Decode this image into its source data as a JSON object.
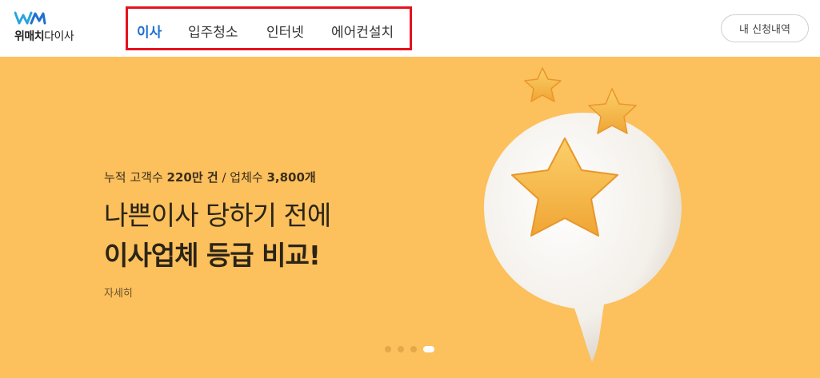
{
  "header": {
    "logo_text_bold": "위매치",
    "logo_text": "다이사",
    "nav": [
      "이사",
      "입주청소",
      "인터넷",
      "에어컨설치"
    ],
    "active_nav": "이사",
    "apply_label": "내 신청내역"
  },
  "banner": {
    "stat_prefix": "누적 고객수 ",
    "stat_customers": "220만 건",
    "stat_sep": " / 업체수 ",
    "stat_companies": "3,800개",
    "headline1": "나쁜이사 당하기 전에",
    "headline2": "이사업체 등급 비교!",
    "detail": "자세히",
    "slides_count": 4,
    "active_slide": 4
  },
  "colors": {
    "banner_bg": "#fcc05c",
    "nav_active": "#1f6fd1",
    "highlight_border": "#e5121e",
    "logo_blue": "#29a3e0"
  },
  "icons": {
    "logo": "wematch-logo-icon",
    "art": "speech-bubble-star-illustration"
  }
}
